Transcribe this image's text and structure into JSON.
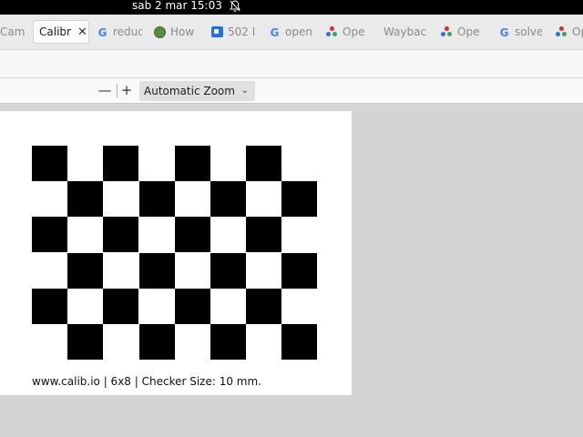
{
  "system": {
    "clock": "sab 2 mar  15:03",
    "notifications_icon": "bell-muted-icon"
  },
  "tabs": [
    {
      "label": "Cam",
      "icon": "none",
      "active": false
    },
    {
      "label": "Calibr",
      "icon": "none",
      "active": true
    },
    {
      "label": "reduc",
      "icon": "google-icon",
      "active": false
    },
    {
      "label": "How",
      "icon": "firefox-icon",
      "active": false
    },
    {
      "label": "502 I",
      "icon": "blue-square-icon",
      "active": false
    },
    {
      "label": "open",
      "icon": "google-icon",
      "active": false
    },
    {
      "label": "Ope",
      "icon": "openai-icon",
      "active": false
    },
    {
      "label": "Waybac",
      "icon": "none",
      "active": false
    },
    {
      "label": "Ope",
      "icon": "openai-icon",
      "active": false
    },
    {
      "label": "solve",
      "icon": "google-icon",
      "active": false
    },
    {
      "label": "Op",
      "icon": "openai-icon",
      "active": false
    }
  ],
  "pdf_toolbar": {
    "zoom_out": "—",
    "zoom_in": "+",
    "zoom_value": "Automatic Zoom"
  },
  "document": {
    "checkerboard": {
      "rows": 6,
      "cols": 8,
      "first_square": "black"
    },
    "caption": "www.calib.io | 6x8 | Checker Size: 10 mm."
  },
  "colors": {
    "viewer_background": "#d4d4d4",
    "page_background": "#ffffff",
    "checker": "#000000",
    "google_blue": "#4285f4"
  }
}
